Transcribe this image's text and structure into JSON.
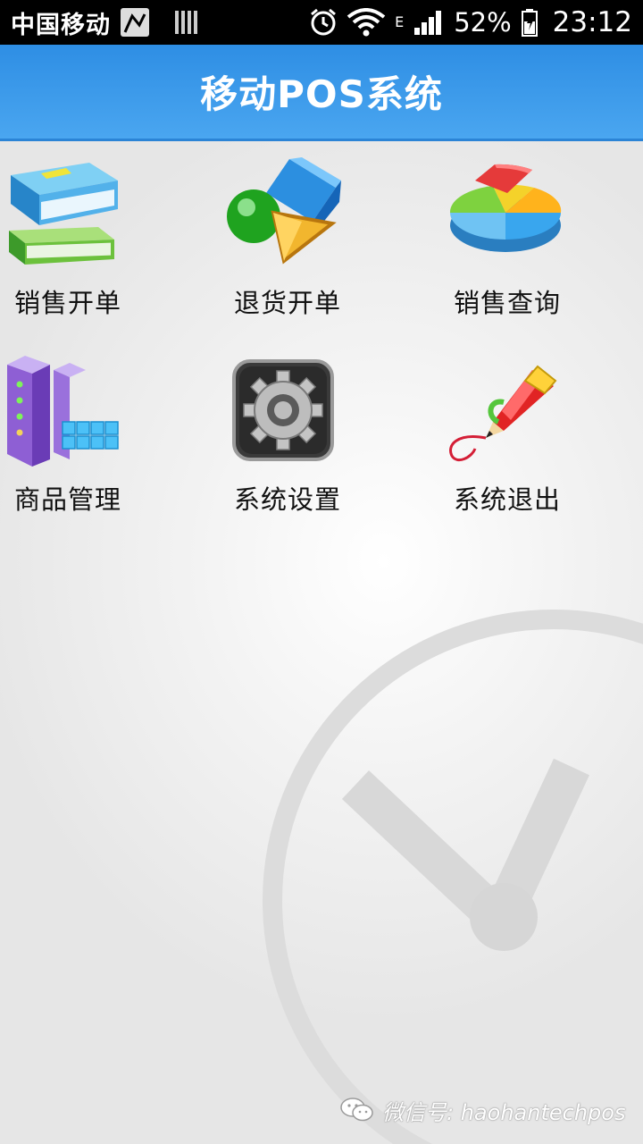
{
  "status_bar": {
    "carrier": "中国移动",
    "network": "E",
    "battery_percent": "52%",
    "time": "23:12"
  },
  "app_bar": {
    "title": "移动POS系统"
  },
  "menu": {
    "items": [
      {
        "label": "销售开单",
        "icon": "books-icon"
      },
      {
        "label": "退货开单",
        "icon": "shapes-icon"
      },
      {
        "label": "销售查询",
        "icon": "pie-chart-icon"
      },
      {
        "label": "商品管理",
        "icon": "server-icon"
      },
      {
        "label": "系统设置",
        "icon": "gear-icon"
      },
      {
        "label": "系统退出",
        "icon": "pen-icon"
      }
    ]
  },
  "footer": {
    "watermark": "微信号: haohantechpos"
  },
  "colors": {
    "app_bar": "#3d9cec",
    "status_bar": "#000000",
    "background": "#ececec"
  }
}
